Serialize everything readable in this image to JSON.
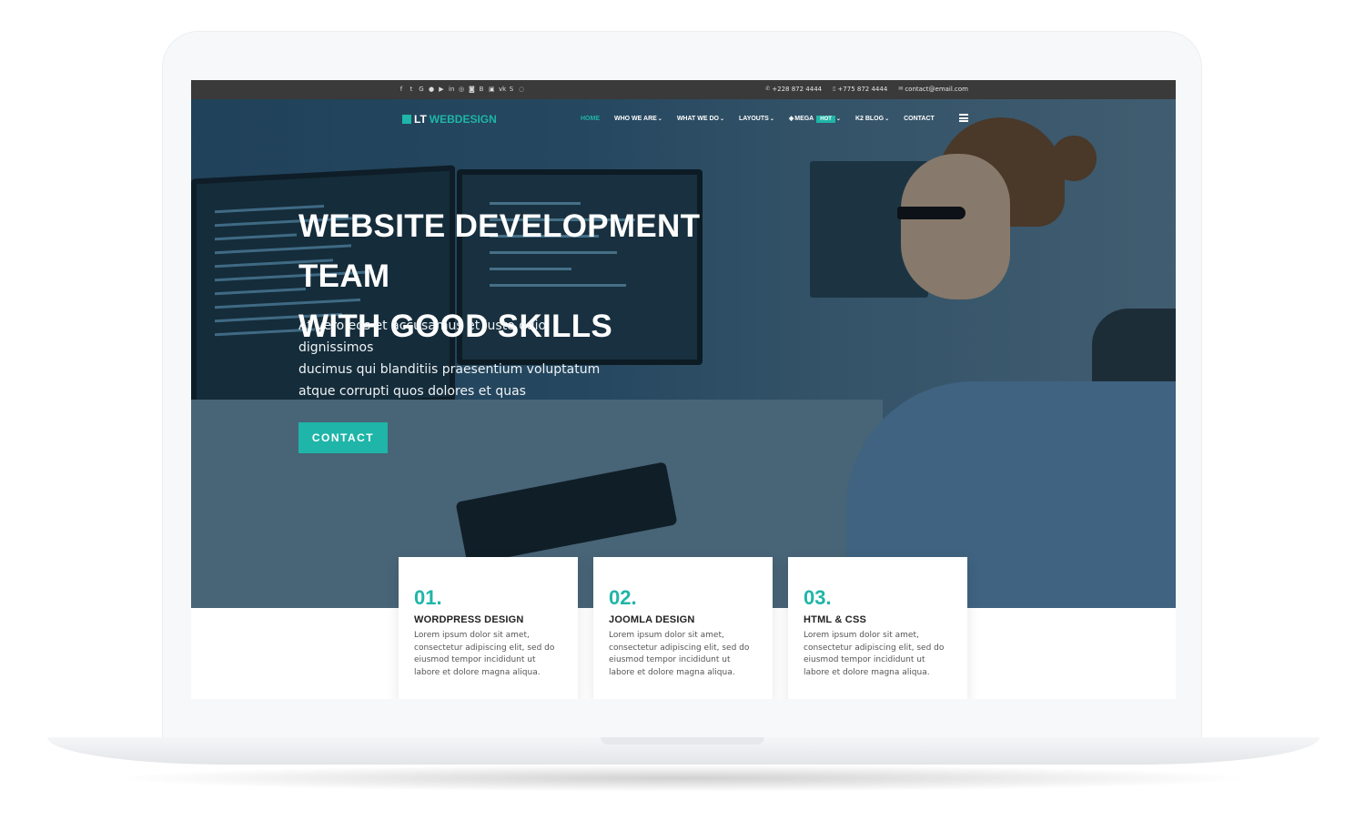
{
  "topbar": {
    "social_icons": [
      "facebook-icon",
      "twitter-icon",
      "google-plus-icon",
      "pinterest-icon",
      "youtube-icon",
      "linkedin-icon",
      "dribbble-icon",
      "instagram-icon",
      "behance-icon",
      "flickr-icon",
      "vk-icon",
      "skype-icon",
      "whatsapp-icon"
    ],
    "phone1": "+228 872 4444",
    "phone2": "+775 872 4444",
    "email": "contact@email.com"
  },
  "nav": {
    "logo_part1": "LT",
    "logo_part2": "WEBDESIGN",
    "items": {
      "home": "HOME",
      "who": "WHO WE ARE",
      "what": "WHAT WE DO",
      "layouts": "LAYOUTS",
      "mega": "MEGA",
      "hot_badge": "HOT",
      "k2": "K2 BLOG",
      "contact": "CONTACT"
    }
  },
  "hero": {
    "title_line1": "WEBSITE DEVELOPMENT TEAM",
    "title_line2": "WITH GOOD SKILLS",
    "text_line1": "At vero eos et accusamus et iusto odio dignissimos",
    "text_line2": "ducimus qui blanditiis praesentium voluptatum",
    "text_line3": "atque corrupti quos dolores et quas",
    "button": "CONTACT"
  },
  "cards": [
    {
      "num": "01.",
      "title": "WORDPRESS DESIGN",
      "text": "Lorem ipsum dolor sit amet, consectetur adipiscing elit, sed do eiusmod tempor incididunt ut labore et dolore magna aliqua."
    },
    {
      "num": "02.",
      "title": "JOOMLA DESIGN",
      "text": "Lorem ipsum dolor sit amet, consectetur adipiscing elit, sed do eiusmod tempor incididunt ut labore et dolore magna aliqua."
    },
    {
      "num": "03.",
      "title": "HTML & CSS",
      "text": "Lorem ipsum dolor sit amet, consectetur adipiscing elit, sed do eiusmod tempor incididunt ut labore et dolore magna aliqua."
    }
  ],
  "colors": {
    "accent": "#1fb5a8",
    "topbar": "#3a3a3a"
  }
}
